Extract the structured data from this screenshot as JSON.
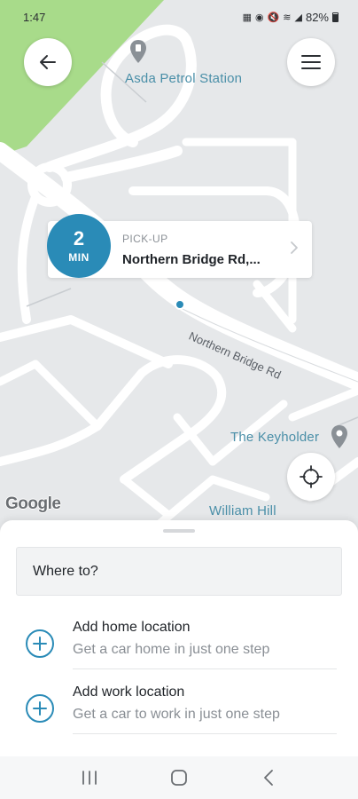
{
  "status_bar": {
    "time": "1:47",
    "battery": "82%"
  },
  "map": {
    "poi_petrol": "Asda Petrol Station",
    "poi_keyholder": "The Keyholder",
    "poi_william_hill": "William Hill",
    "street_name": "Northern Bridge Rd",
    "attribution": "Google"
  },
  "pickup": {
    "eta_value": "2",
    "eta_unit": "MIN",
    "label": "PICK-UP",
    "address": "Northern Bridge Rd,..."
  },
  "sheet": {
    "where_to_placeholder": "Where to?",
    "home_title": "Add home location",
    "home_subtitle": "Get a car home in just one step",
    "work_title": "Add work location",
    "work_subtitle": "Get a car to work in just one step"
  },
  "colors": {
    "accent": "#2a8bb7",
    "park_green": "#a8db8a"
  }
}
